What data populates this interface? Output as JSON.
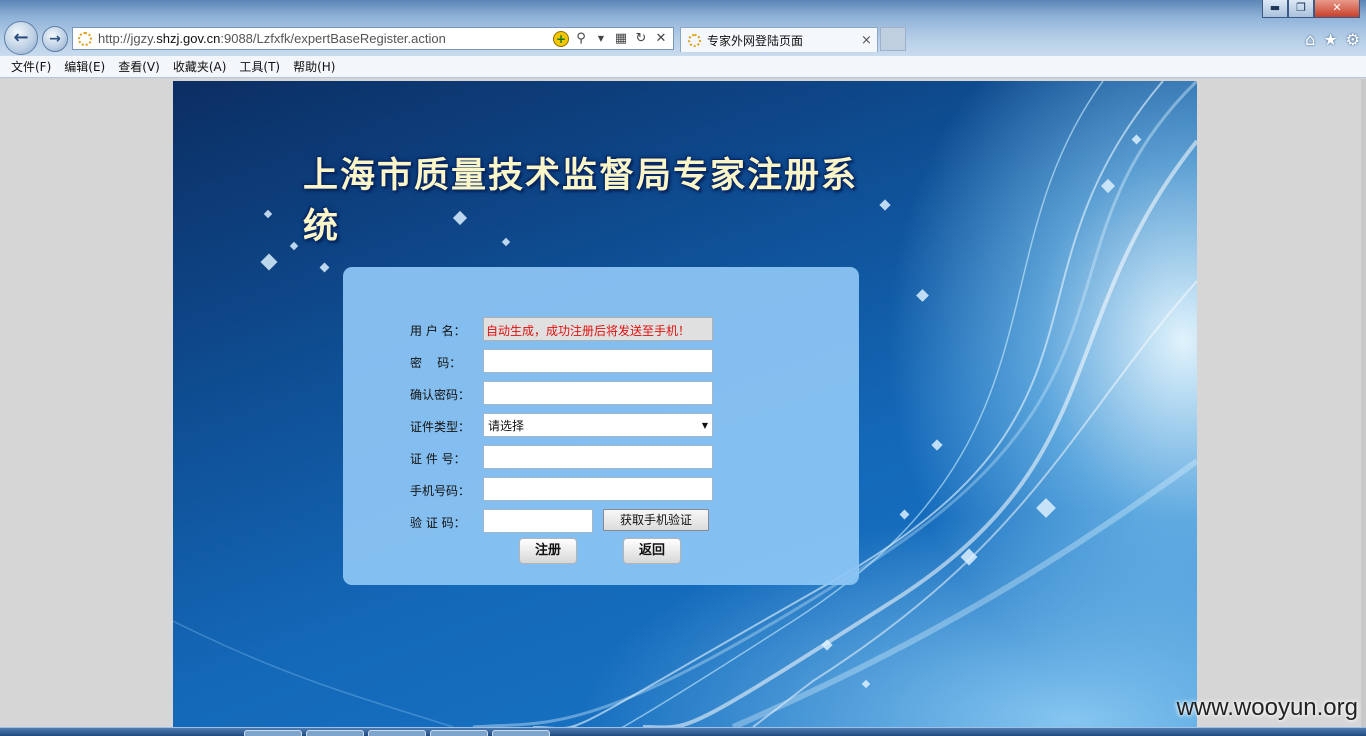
{
  "browser": {
    "url_prefix": "http://jgzy.",
    "url_host": "shzj.gov.cn",
    "url_suffix": ":9088/Lzfxfk/expertBaseRegister.action",
    "tab_title": "专家外网登陆页面",
    "tab_close": "×",
    "menu": [
      "文件(F)",
      "编辑(E)",
      "查看(V)",
      "收藏夹(A)",
      "工具(T)",
      "帮助(H)"
    ],
    "icons": {
      "back": "back-arrow-icon",
      "forward": "forward-arrow-icon",
      "compat": "compatibility-view-icon",
      "search": "search-icon",
      "refresh": "refresh-icon",
      "stop": "stop-icon",
      "home": "home-icon",
      "favorites": "favorites-star-icon",
      "tools": "tools-gear-icon"
    }
  },
  "page": {
    "title": "上海市质量技术监督局专家注册系统",
    "form": {
      "username_label": "用 户 名：",
      "username_value": "自动生成，成功注册后将发送至手机！",
      "password_label": "密    码：",
      "confirm_label": "确认密码：",
      "idtype_label": "证件类型：",
      "idtype_value": "请选择",
      "idno_label": "证 件 号：",
      "phone_label": "手机号码：",
      "code_label": "验 证 码：",
      "sms_button": "获取手机验证",
      "register_button": "注册",
      "back_button": "返回"
    }
  },
  "watermark": "www.wooyun.org",
  "colors": {
    "panel": "#8dc6f5",
    "username_hint": "#e0110f",
    "title": "#fbf6c8"
  }
}
